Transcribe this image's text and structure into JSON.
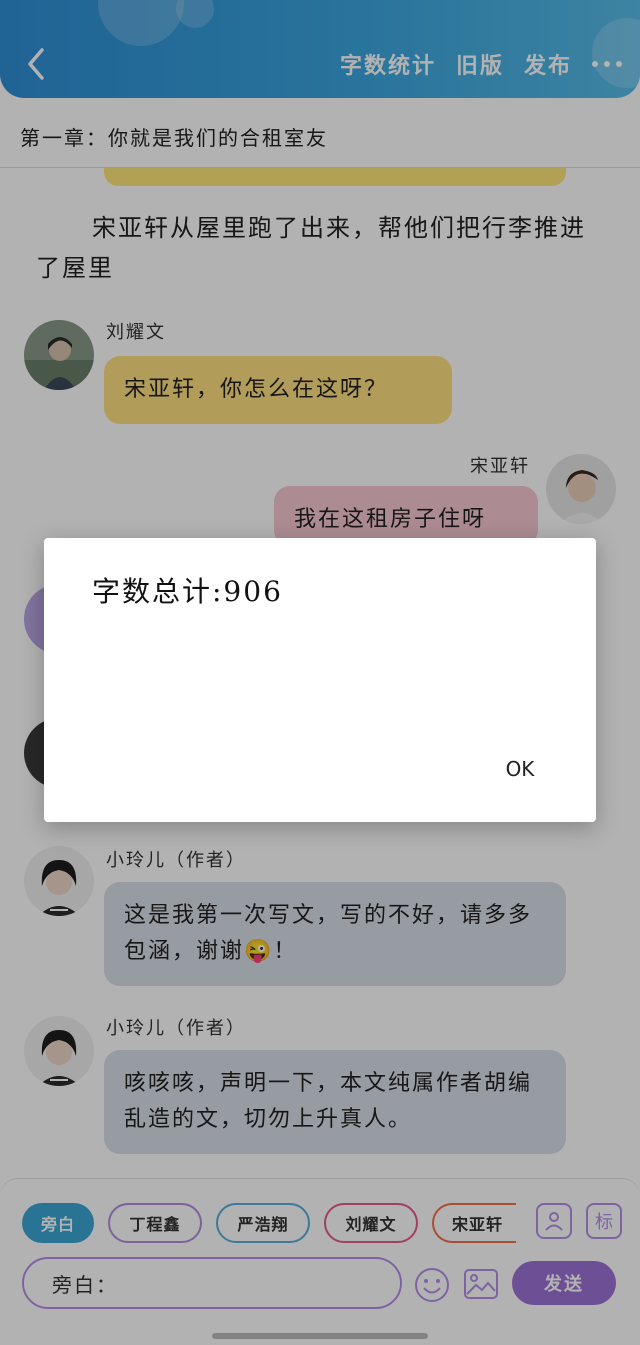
{
  "header": {
    "back_icon": "back-arrow-icon",
    "word_count": "字数统计",
    "old_version": "旧版",
    "publish": "发布",
    "more_icon": "more-icon"
  },
  "chapter_title": "第一章：你就是我们的合租室友",
  "narration": "宋亚轩从屋里跑了出来，帮他们把行李推进了屋里",
  "messages": [
    {
      "name": "刘耀文",
      "text": "宋亚轩，你怎么在这呀？"
    },
    {
      "name": "宋亚轩",
      "text": "我在这租房子住呀"
    },
    {
      "name": "小玲儿（作者）",
      "text": "这是我第一次写文，写的不好，请多多包涵，谢谢😜！"
    },
    {
      "name": "小玲儿（作者）",
      "text": "咳咳咳，声明一下，本文纯属作者胡编乱造的文，切勿上升真人。"
    }
  ],
  "chips": {
    "active": "旁白",
    "c1": "丁程鑫",
    "c2": "严浩翔",
    "c3": "刘耀文",
    "c4": "宋亚轩"
  },
  "input": {
    "label": "旁白："
  },
  "send_label": "发送",
  "side_icons": {
    "person": "person-icon",
    "tag_label": "标"
  },
  "dialog": {
    "text": "字数总计:906",
    "ok": "OK"
  },
  "colors": {
    "header": "#3aa6e0",
    "accent_purple": "#9b72d6",
    "bubble_yellow": "#ffe082",
    "bubble_pink": "#f6c9d2",
    "bubble_gray": "#d9dfe8"
  }
}
